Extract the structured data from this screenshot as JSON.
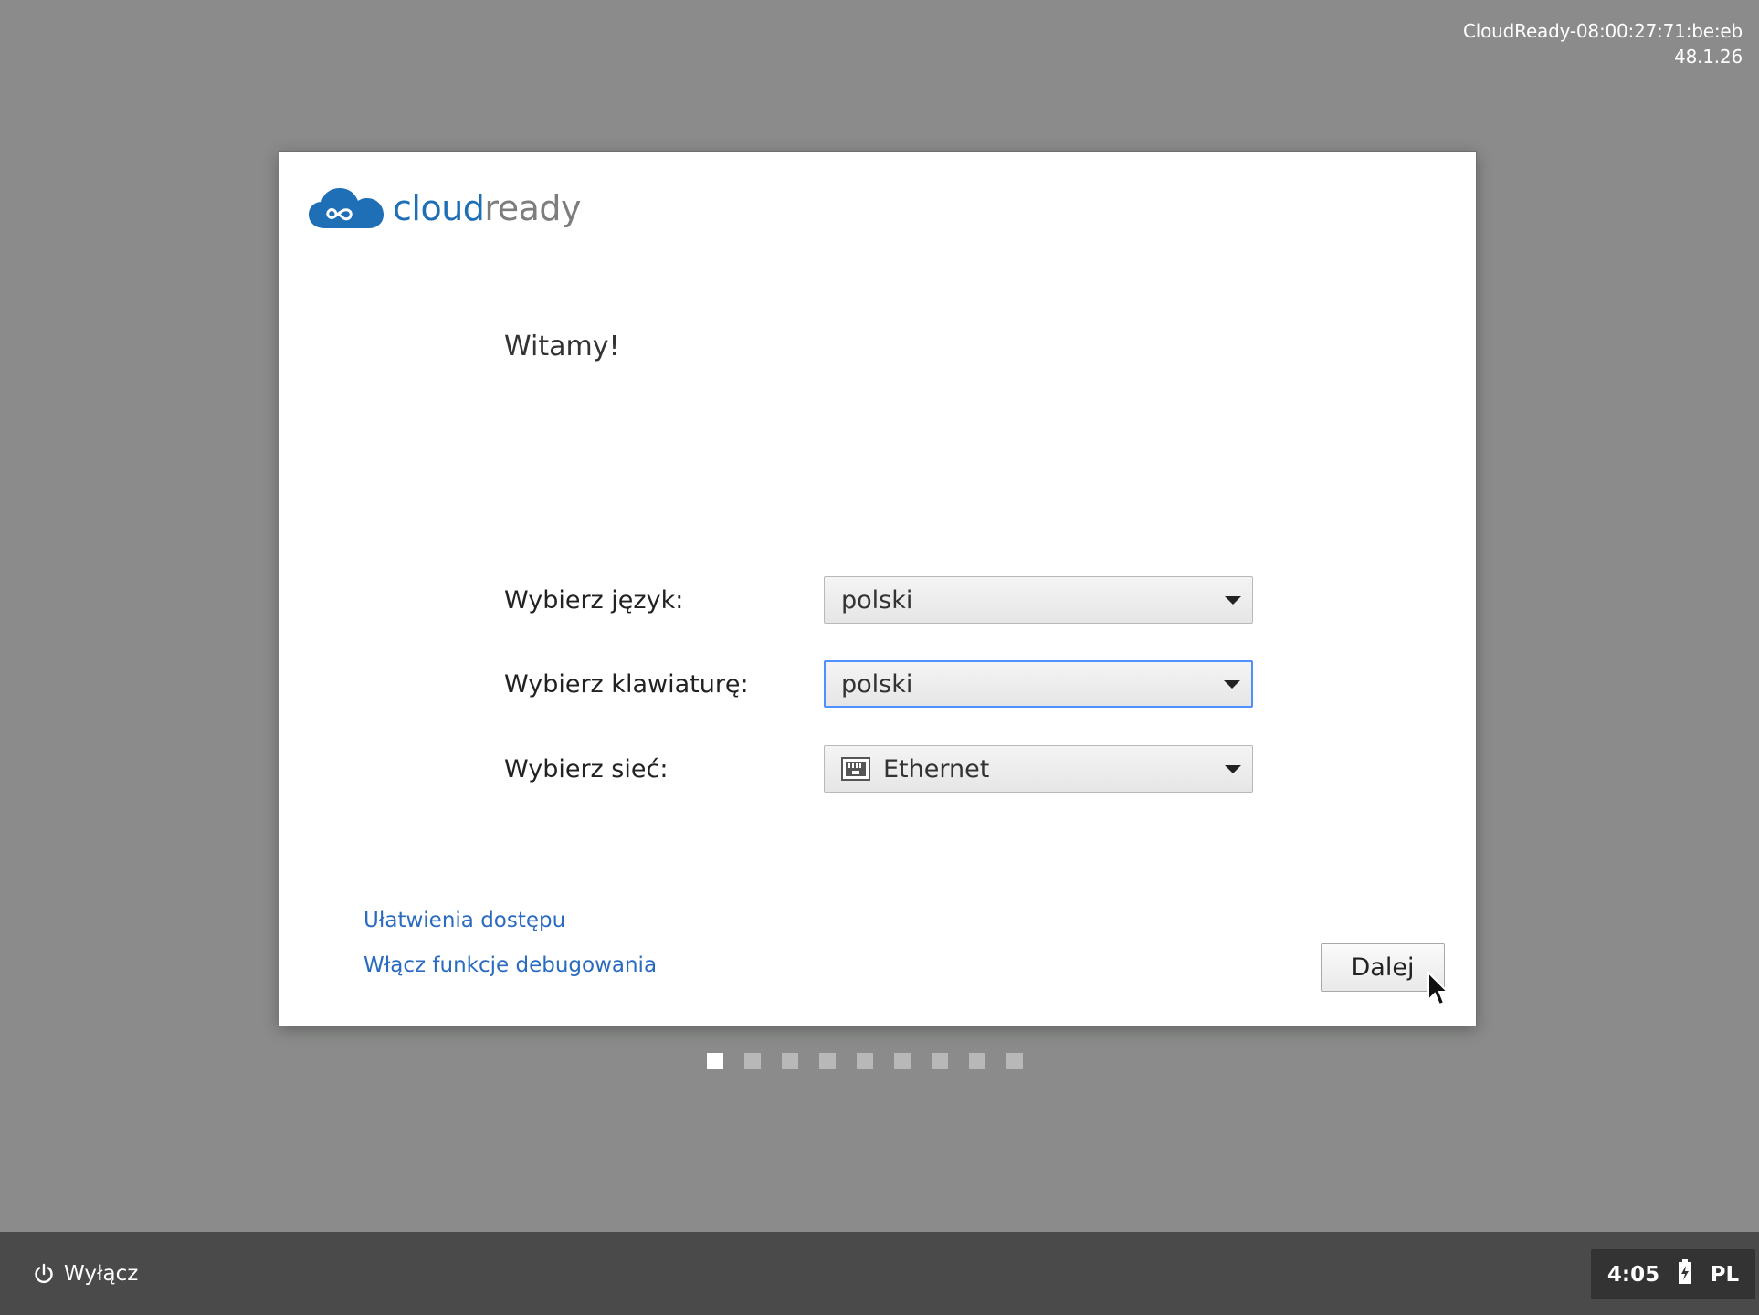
{
  "device": {
    "hostname": "CloudReady-08:00:27:71:be:eb",
    "version": "48.1.26"
  },
  "logo": {
    "word_cloud": "cloud",
    "word_ready": "ready",
    "icon": "cloud-infinity-icon",
    "brand_color": "#1f6fb6"
  },
  "welcome": {
    "title": "Witamy!",
    "language": {
      "label": "Wybierz język:",
      "value": "polski"
    },
    "keyboard": {
      "label": "Wybierz klawiaturę:",
      "value": "polski"
    },
    "network": {
      "label": "Wybierz sieć:",
      "value": "Ethernet",
      "icon": "ethernet-icon"
    },
    "accessibility_link": "Ułatwienia dostępu",
    "debug_link": "Włącz funkcje debugowania",
    "next_button": "Dalej"
  },
  "steps": {
    "count": 9,
    "active_index": 0
  },
  "shelf": {
    "shutdown_label": "Wyłącz",
    "shutdown_icon": "power-icon",
    "time": "4:05",
    "battery_icon": "battery-charging-icon",
    "input_method": "PL"
  },
  "colors": {
    "background": "#8a8b8a",
    "link": "#2a6bc0",
    "focus": "#4d90fe",
    "shelf": "#4a4a4a"
  }
}
